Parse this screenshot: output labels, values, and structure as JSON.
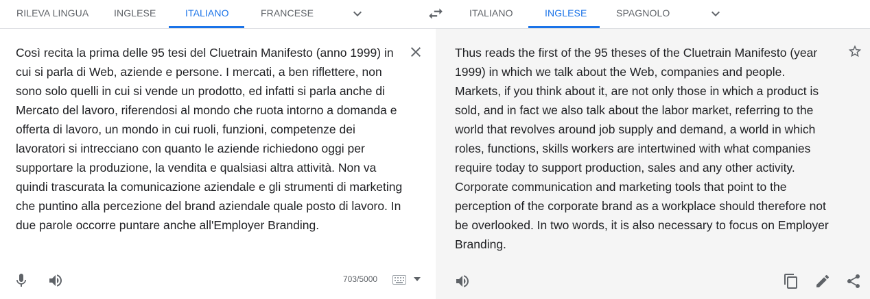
{
  "source_tabs": [
    "RILEVA LINGUA",
    "INGLESE",
    "ITALIANO",
    "FRANCESE"
  ],
  "target_tabs": [
    "ITALIANO",
    "INGLESE",
    "SPAGNOLO"
  ],
  "source_text": "Così recita la prima delle 95 tesi del Cluetrain Manifesto (anno 1999) in cui si parla di Web, aziende e persone. I mercati, a ben riflettere, non sono solo quelli in cui si vende un prodotto, ed infatti si parla anche di Mercato del lavoro, riferendosi al mondo che ruota intorno a domanda e offerta di lavoro, un mondo in cui ruoli, funzioni, competenze dei lavoratori si intrecciano con quanto le aziende richiedono oggi per supportare la produzione, la vendita e qualsiasi altra attività. Non va quindi trascurata la comunicazione aziendale e gli strumenti di marketing che puntino alla percezione del brand aziendale quale posto di lavoro. In due parole occorre puntare anche all'Employer Branding.",
  "translated_text": "Thus reads the first of the 95 theses of the Cluetrain Manifesto (year 1999) in which we talk about the Web, companies and people. Markets, if you think about it, are not only those in which a product is sold, and in fact we also talk about the labor market, referring to the world that revolves around job supply and demand, a world in which roles, functions, skills workers are intertwined with what companies require today to support production, sales and any other activity. Corporate communication and marketing tools that point to the perception of the corporate brand as a workplace should therefore not be overlooked. In two words, it is also necessary to focus on Employer Branding.",
  "char_counter": "703/5000",
  "accent_color": "#1a73e8",
  "icons": [
    "chevron-down",
    "swap",
    "close",
    "star-outline",
    "microphone",
    "speaker",
    "keyboard",
    "copy",
    "edit-pencil",
    "share"
  ]
}
